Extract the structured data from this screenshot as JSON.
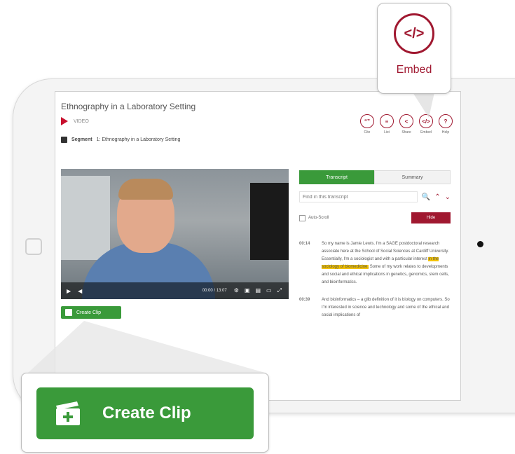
{
  "page": {
    "title": "Ethnography in a Laboratory Setting",
    "type_label": "VIDEO",
    "segment_label": "Segment",
    "segment_text": "1: Ethnography in a Laboratory Setting"
  },
  "tools": [
    {
      "label": "Cite",
      "icon": "cite-icon",
      "glyph": "“”"
    },
    {
      "label": "List",
      "icon": "list-icon",
      "glyph": "≡"
    },
    {
      "label": "Share",
      "icon": "share-icon",
      "glyph": "<"
    },
    {
      "label": "Embed",
      "icon": "embed-icon",
      "glyph": "</>"
    },
    {
      "label": "Help",
      "icon": "help-icon",
      "glyph": "?"
    }
  ],
  "video": {
    "time": "00:00 / 13:07"
  },
  "clip": {
    "small_label": "Create Clip",
    "big_label": "Create Clip"
  },
  "tabs": {
    "transcript": "Transcript",
    "summary": "Summary"
  },
  "find": {
    "placeholder": "Find in this transcript"
  },
  "autoscroll": {
    "label": "Auto-Scroll",
    "hide_label": "Hide"
  },
  "transcript": [
    {
      "time": "00:14",
      "before": "So my name is Jamie Lewis. I'm a SAGE postdoctoral research associate here at the School of Social Sciences at Cardiff University. Essentially, I'm a sociologist and with a particular interest ",
      "highlight": "in the sociology of biomedicine.",
      "after": " Some of my work relates to developments and social and ethical implications in genetics, genomics, stem cells, and bioinformatics."
    },
    {
      "time": "00:39",
      "before": "And bioinformatics – a glib definition of it is biology on computers. So I'm interested in science and technology and some of the ethical and social implications of",
      "highlight": "",
      "after": ""
    }
  ],
  "embed_callout": {
    "label": "Embed"
  },
  "colors": {
    "brand_red": "#a01830",
    "clip_green": "#3a9a3a",
    "highlight": "#f2c200"
  }
}
